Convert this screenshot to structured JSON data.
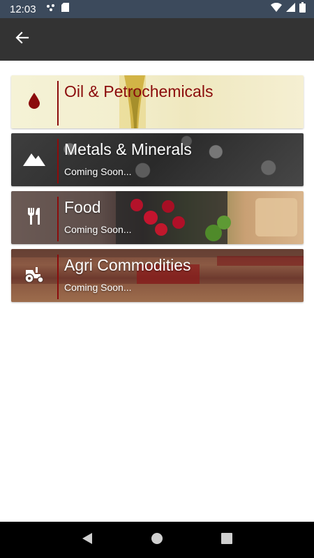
{
  "status_bar": {
    "time": "12:03",
    "icons": [
      "notification-dots-icon",
      "sd-card-icon",
      "wifi-icon",
      "signal-icon",
      "battery-icon"
    ]
  },
  "app_bar": {
    "back_icon": "arrow-left-icon"
  },
  "categories": [
    {
      "title": "Oil & Petrochemicals",
      "subtitle": "",
      "icon": "drop-icon"
    },
    {
      "title": "Metals & Minerals",
      "subtitle": "Coming Soon...",
      "icon": "mountain-icon"
    },
    {
      "title": "Food",
      "subtitle": "Coming Soon...",
      "icon": "fork-knife-icon"
    },
    {
      "title": "Agri Commodities",
      "subtitle": "Coming Soon...",
      "icon": "tractor-icon"
    }
  ],
  "nav_bar": {
    "icons": [
      "back-triangle-icon",
      "home-circle-icon",
      "recents-square-icon"
    ]
  },
  "colors": {
    "accent": "#8b0c0c",
    "app_bar": "#333333",
    "status_bar": "#3c4a5c"
  }
}
